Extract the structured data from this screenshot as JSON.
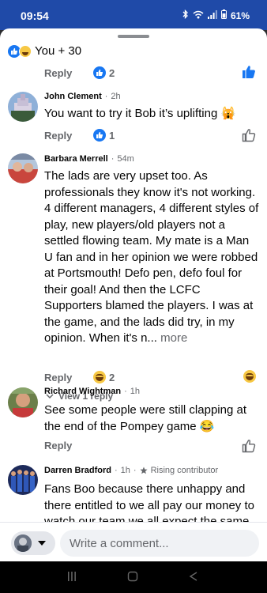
{
  "status": {
    "time": "09:54",
    "battery": "61%"
  },
  "post_reactions": {
    "count_text": "You + 30"
  },
  "reply_label": "Reply",
  "comments": [
    {
      "author": "",
      "time": "",
      "badge": "",
      "text": "",
      "reaction_count": "2",
      "liked": true
    },
    {
      "author": "John Clement",
      "time": "2h",
      "badge": "",
      "text": "You want to try it Bob it’s uplifting 🙀",
      "reaction_count": "1"
    },
    {
      "author": "Barbara Merrell",
      "time": "54m",
      "badge": "",
      "text": "The lads are very upset too. As professionals they know it's not working. 4 different managers, 4 different styles of play, new players/old players not a settled flowing team. My mate is a Man U fan and in her opinion we were robbed at Portsmouth! Defo pen, defo foul for their goal! And then the LCFC Supporters blamed the players. I was at the game, and the lads did try, in my opinion. When it's n...",
      "more": "more",
      "reaction_count": "2",
      "view_replies": "View 1 reply"
    },
    {
      "author": "Richard Wightman",
      "time": "1h",
      "badge": "",
      "text": "See some people were still clapping at the end of the Pompey game 😂",
      "reaction_count": ""
    },
    {
      "author": "Darren Bradford",
      "time": "1h",
      "badge": "Rising contributor",
      "text": "Fans Boo because there unhappy and there entitled to we all pay our money to watch our team we all expect the same",
      "reaction_count": ""
    }
  ],
  "composer": {
    "placeholder": "Write a comment..."
  },
  "icons": {
    "like": "thumbs-up-icon",
    "haha": "haha-emoji-icon",
    "star": "star-icon",
    "chevron": "chevron-down-icon"
  },
  "colors": {
    "brand_blue": "#1877f2",
    "status_bar": "#1f4aa8",
    "muted": "#65676b"
  }
}
